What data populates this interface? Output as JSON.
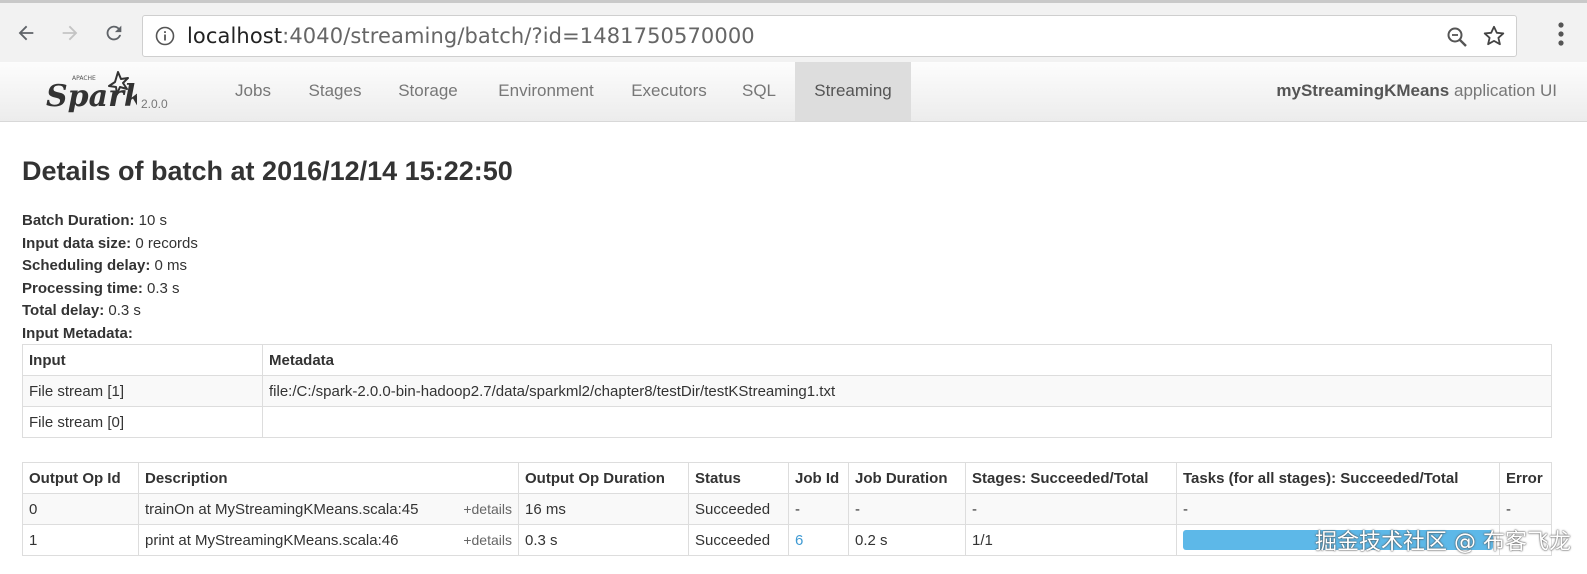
{
  "browser": {
    "url_host": "localhost",
    "url_rest": ":4040/streaming/batch/?id=1481750570000"
  },
  "spark": {
    "version": "2.0.0",
    "tabs": [
      {
        "label": "Jobs"
      },
      {
        "label": "Stages"
      },
      {
        "label": "Storage"
      },
      {
        "label": "Environment"
      },
      {
        "label": "Executors"
      },
      {
        "label": "SQL"
      },
      {
        "label": "Streaming"
      }
    ],
    "active_tab": "Streaming",
    "app_name": "myStreamingKMeans",
    "app_suffix": " application UI"
  },
  "page": {
    "title": "Details of batch at 2016/12/14 15:22:50",
    "summary": {
      "batch_duration_label": "Batch Duration:",
      "batch_duration": " 10 s",
      "input_size_label": "Input data size:",
      "input_size": " 0 records",
      "scheduling_label": "Scheduling delay:",
      "scheduling": " 0 ms",
      "processing_label": "Processing time:",
      "processing": " 0.3 s",
      "total_label": "Total delay:",
      "total": " 0.3 s",
      "metadata_label": "Input Metadata:"
    }
  },
  "metadata_table": {
    "headers": [
      "Input",
      "Metadata"
    ],
    "rows": [
      [
        "File stream [1]",
        "file:/C:/spark-2.0.0-bin-hadoop2.7/data/sparkml2/chapter8/testDir/testKStreaming1.txt"
      ],
      [
        "File stream [0]",
        ""
      ]
    ]
  },
  "ops_table": {
    "headers": [
      "Output Op Id",
      "Description",
      "Output Op Duration",
      "Status",
      "Job Id",
      "Job Duration",
      "Stages: Succeeded/Total",
      "Tasks (for all stages): Succeeded/Total",
      "Error"
    ],
    "rows": [
      {
        "id": "0",
        "desc": "trainOn at MyStreamingKMeans.scala:45",
        "details": "+details",
        "op_duration": "16 ms",
        "status": "Succeeded",
        "job_id": "-",
        "job_duration": "-",
        "stages": "-",
        "tasks": "-",
        "error": "-"
      },
      {
        "id": "1",
        "desc": "print at MyStreamingKMeans.scala:46",
        "details": "+details",
        "op_duration": "0.3 s",
        "status": "Succeeded",
        "job_id": "6",
        "job_duration": "0.2 s",
        "stages": "1/1",
        "tasks_progress": 1.0,
        "error": ""
      }
    ]
  },
  "watermark": "掘金技术社区 @ 布客飞龙",
  "colors": {
    "link": "#3f9ad3",
    "progress": "#5db8e8",
    "active_tab_bg": "#dddddd"
  }
}
